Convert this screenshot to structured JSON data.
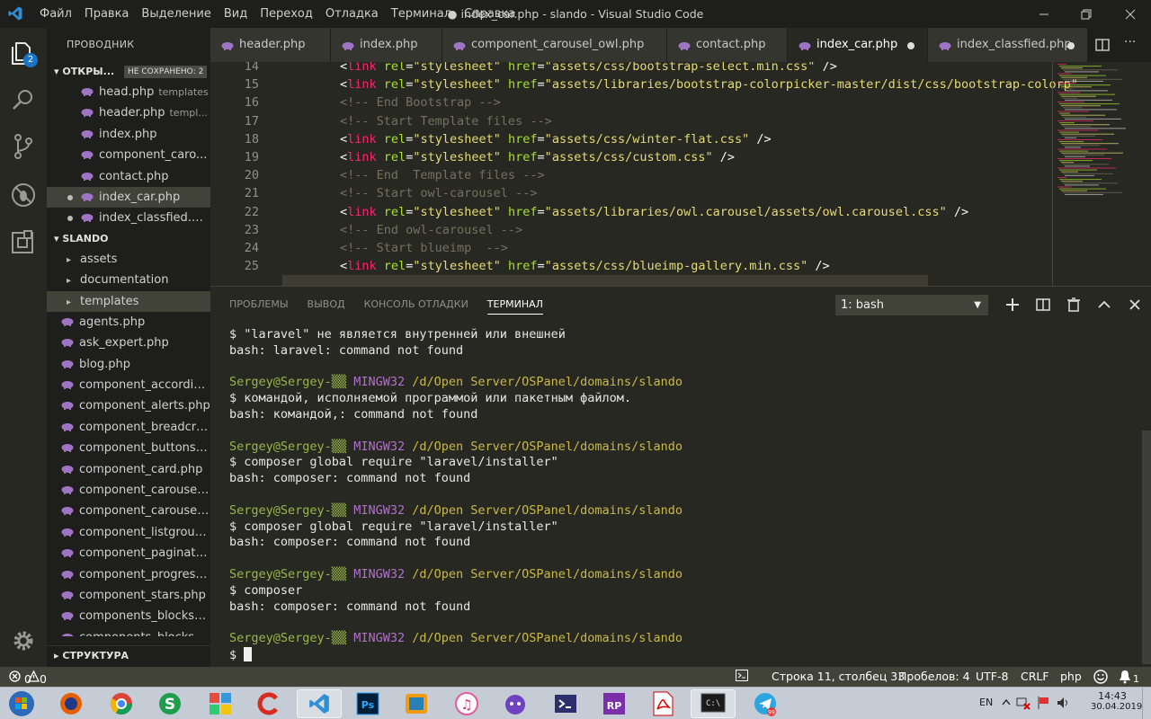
{
  "titlebar": {
    "menu": [
      "Файл",
      "Правка",
      "Выделение",
      "Вид",
      "Переход",
      "Отладка",
      "Терминал",
      "Справка"
    ],
    "window_title": "● index_car.php - slando - Visual Studio Code"
  },
  "activity": {
    "badge": "2"
  },
  "sidebar": {
    "title": "ПРОВОДНИК",
    "open_section": "ОТКРЫ...",
    "unsaved_badge": "НЕ СОХРАНЕНО: 2",
    "open_files": [
      {
        "name": "head.php",
        "hint": "templates"
      },
      {
        "name": "header.php",
        "hint": "templ..."
      },
      {
        "name": "index.php",
        "hint": ""
      },
      {
        "name": "component_caro...",
        "hint": ""
      },
      {
        "name": "contact.php",
        "hint": ""
      },
      {
        "name": "index_car.php",
        "hint": ""
      },
      {
        "name": "index_classfied.php",
        "hint": ""
      }
    ],
    "project_section": "SLANDO",
    "folders": [
      "assets",
      "documentation",
      "templates"
    ],
    "files": [
      "agents.php",
      "ask_expert.php",
      "blog.php",
      "component_accordio...",
      "component_alerts.php",
      "component_breadcru...",
      "component_buttons.p...",
      "component_card.php",
      "component_carousel_...",
      "component_carousel_...",
      "component_listgroup....",
      "component_paginatio...",
      "component_progress....",
      "component_stars.php",
      "components_blocks_...",
      "components_blocks_..."
    ],
    "outline_section": "СТРУКТУРА"
  },
  "tabs": [
    "header.php",
    "index.php",
    "component_carousel_owl.php",
    "contact.php",
    "index_car.php",
    "index_classfied.php"
  ],
  "editor": {
    "line_numbers": [
      "14",
      "15",
      "16",
      "17",
      "18",
      "19",
      "20",
      "21",
      "22",
      "23",
      "24",
      "25"
    ],
    "lines": [
      {
        "t": "link",
        "href": "assets/css/bootstrap-select.min.css"
      },
      {
        "t": "link",
        "href": "assets/libraries/bootstrap-colorpicker-master/dist/css/bootstrap-colorp"
      },
      {
        "t": "comment",
        "text": "<!-- End Bootstrap -->"
      },
      {
        "t": "comment",
        "text": "<!-- Start Template files -->"
      },
      {
        "t": "link",
        "href": "assets/css/winter-flat.css"
      },
      {
        "t": "link",
        "href": "assets/css/custom.css"
      },
      {
        "t": "comment",
        "text": "<!-- End  Template files -->"
      },
      {
        "t": "comment",
        "text": "<!-- Start owl-carousel -->"
      },
      {
        "t": "link",
        "href": "assets/libraries/owl.carousel/assets/owl.carousel.css"
      },
      {
        "t": "comment",
        "text": "<!-- End owl-carousel -->"
      },
      {
        "t": "comment",
        "text": "<!-- Start blueimp  -->"
      },
      {
        "t": "link",
        "href": "assets/css/blueimp-gallery.min.css"
      }
    ],
    "tokens": {
      "open": "<",
      "tag": "link",
      "attr_rel": "rel",
      "eq": "=",
      "rel_val": "\"stylesheet\"",
      "attr_href": "href",
      "close": " />"
    }
  },
  "panel": {
    "tabs": [
      "ПРОБЛЕМЫ",
      "ВЫВОД",
      "КОНСОЛЬ ОТЛАДКИ",
      "ТЕРМИНАЛ"
    ],
    "terminal_select": "1: bash",
    "prompt_user": "Sergey@Sergey-▒▒",
    "prompt_ming": "MINGW32",
    "prompt_path": "/d/Open Server/OSPanel/domains/slando",
    "lines": [
      "$ \"laravel\" не является внутренней или внешней",
      "bash: laravel: command not found",
      "",
      "PROMPT",
      "$ командой, исполняемой программой или пакетным файлом.",
      "bash: командой,: command not found",
      "",
      "PROMPT",
      "$ composer global require \"laravel/installer\"",
      "bash: composer: command not found",
      "",
      "PROMPT",
      "$ composer global require \"laravel/installer\"",
      "bash: composer: command not found",
      "",
      "PROMPT",
      "$ composer",
      "bash: composer: command not found",
      "",
      "PROMPT",
      "$ "
    ]
  },
  "status": {
    "errors": "0",
    "warnings": "0",
    "position": "Строка 11, столбец 33",
    "spaces": "Пробелов: 4",
    "encoding": "UTF-8",
    "eol": "CRLF",
    "language": "php",
    "notifications": "1"
  },
  "taskbar": {
    "lang": "EN",
    "time": "14:43",
    "date": "30.04.2019",
    "telegram_badge": "99"
  },
  "colors": {
    "bg": "#272822",
    "sidebar": "#1e1f1c",
    "status": "#414339",
    "accent": "#f92672",
    "string": "#e6db74",
    "attr": "#a6e22e",
    "comment": "#75715e"
  }
}
